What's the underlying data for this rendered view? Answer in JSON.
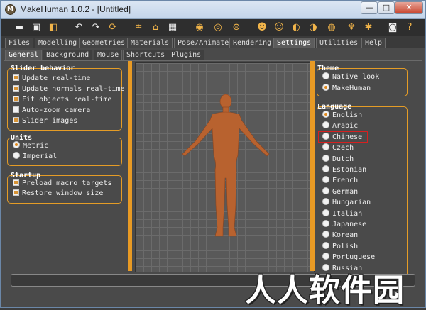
{
  "window": {
    "title": "MakeHuman 1.0.2 - [Untitled]",
    "logo_glyph": "M",
    "minimize": "—",
    "maximize": "□",
    "close": "✕"
  },
  "toolbar": [
    {
      "name": "save-icon",
      "glyph": "▬",
      "accent": false
    },
    {
      "name": "disk-icon",
      "glyph": "▣",
      "accent": false
    },
    {
      "name": "export-icon",
      "glyph": "◧",
      "accent": true
    },
    {
      "name": "undo-icon",
      "glyph": "↶",
      "accent": false
    },
    {
      "name": "redo-icon",
      "glyph": "↷",
      "accent": false
    },
    {
      "name": "reset-icon",
      "glyph": "⟳",
      "accent": true
    },
    {
      "name": "smooth-icon",
      "glyph": "♒",
      "accent": true
    },
    {
      "name": "wireframe-icon",
      "glyph": "⌂",
      "accent": true
    },
    {
      "name": "checker-icon",
      "glyph": "▦",
      "accent": false
    },
    {
      "name": "view-front-icon",
      "glyph": "◉",
      "accent": true
    },
    {
      "name": "view-back-icon",
      "glyph": "◎",
      "accent": true
    },
    {
      "name": "view-side-icon",
      "glyph": "⊜",
      "accent": true
    },
    {
      "name": "view-top-icon",
      "glyph": "☻",
      "accent": true
    },
    {
      "name": "view-bottom-icon",
      "glyph": "☺",
      "accent": true
    },
    {
      "name": "view-left-icon",
      "glyph": "◐",
      "accent": true
    },
    {
      "name": "view-right-icon",
      "glyph": "◑",
      "accent": true
    },
    {
      "name": "reset-camera-icon",
      "glyph": "◍",
      "accent": true
    },
    {
      "name": "hands-icon",
      "glyph": "♆",
      "accent": true
    },
    {
      "name": "pose-icon",
      "glyph": "✱",
      "accent": true
    },
    {
      "name": "camera-icon",
      "glyph": "◙",
      "accent": false
    },
    {
      "name": "help-icon",
      "glyph": "?",
      "accent": true
    }
  ],
  "main_tabs": [
    "Files",
    "Modelling",
    "Geometries",
    "Materials",
    "Pose/Animate",
    "Rendering",
    "Settings",
    "Utilities",
    "Help"
  ],
  "active_main_tab": "Settings",
  "sub_tabs": [
    "General",
    "Background",
    "Mouse",
    "Shortcuts",
    "Plugins"
  ],
  "active_sub_tab": "General",
  "slider_behavior": {
    "title": "Slider behavior",
    "items": [
      {
        "label": "Update real-time",
        "checked": true
      },
      {
        "label": "Update normals real-time",
        "checked": true
      },
      {
        "label": "Fit objects real-time",
        "checked": true
      },
      {
        "label": "Auto-zoom camera",
        "checked": false
      },
      {
        "label": "Slider images",
        "checked": true
      }
    ]
  },
  "units": {
    "title": "Units",
    "items": [
      {
        "label": "Metric",
        "selected": true
      },
      {
        "label": "Imperial",
        "selected": false
      }
    ]
  },
  "startup": {
    "title": "Startup",
    "items": [
      {
        "label": "Preload macro targets",
        "checked": true
      },
      {
        "label": "Restore window size",
        "checked": true
      }
    ]
  },
  "theme": {
    "title": "Theme",
    "items": [
      {
        "label": "Native look",
        "selected": false
      },
      {
        "label": "MakeHuman",
        "selected": true
      }
    ]
  },
  "language": {
    "title": "Language",
    "items": [
      {
        "label": "English",
        "selected": true
      },
      {
        "label": "Arabic",
        "selected": false
      },
      {
        "label": "Chinese",
        "selected": false
      },
      {
        "label": "Czech",
        "selected": false
      },
      {
        "label": "Dutch",
        "selected": false
      },
      {
        "label": "Estonian",
        "selected": false
      },
      {
        "label": "French",
        "selected": false
      },
      {
        "label": "German",
        "selected": false
      },
      {
        "label": "Hungarian",
        "selected": false
      },
      {
        "label": "Italian",
        "selected": false
      },
      {
        "label": "Japanese",
        "selected": false
      },
      {
        "label": "Korean",
        "selected": false
      },
      {
        "label": "Polish",
        "selected": false
      },
      {
        "label": "Portuguese",
        "selected": false
      },
      {
        "label": "Russian",
        "selected": false
      }
    ]
  },
  "watermark": "人人软件园",
  "colors": {
    "accent": "#e59c26",
    "panel": "#4a4a4a",
    "highlight_box": "#d62020",
    "skin": "#b8622f"
  }
}
